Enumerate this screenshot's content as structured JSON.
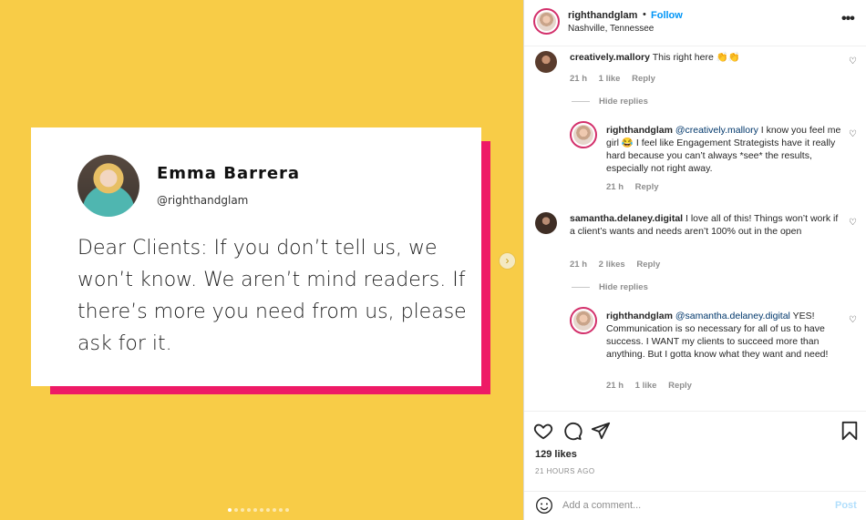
{
  "media": {
    "card": {
      "name": "Emma Barrera",
      "handle": "@righthandglam",
      "quote": "Dear Clients: If you don’t tell us, we won’t know. We aren’t mind readers. If there’s more you need from us, please ask for it."
    },
    "colors": {
      "background": "#f8cc47",
      "accent_shadow": "#ee1a66"
    },
    "carousel": {
      "dots": 10,
      "active_index": 0,
      "next_icon": "chevron-right-icon"
    }
  },
  "post_header": {
    "username": "righthandglam",
    "separator": "•",
    "follow_label": "Follow",
    "location": "Nashville, Tennessee",
    "more_icon": "more-horizontal-icon"
  },
  "comments": [
    {
      "username": "creatively.mallory",
      "text": "This right here 👏👏",
      "time": "21 h",
      "likes": "1 like",
      "reply_label": "Reply",
      "hide_replies": "Hide replies",
      "replies": [
        {
          "username": "righthandglam",
          "mention": "@creatively.mallory",
          "text": " I know you feel me girl 😂 I feel like Engagement Strategists have it really hard because you can’t always *see* the results, especially not right away.",
          "time": "21 h",
          "reply_label": "Reply"
        }
      ]
    },
    {
      "username": "samantha.delaney.digital",
      "text": "I love all of this! Things won’t work if a client’s wants and needs aren’t 100% out in the open",
      "time": "21 h",
      "likes": "2 likes",
      "reply_label": "Reply",
      "hide_replies": "Hide replies",
      "replies": [
        {
          "username": "righthandglam",
          "mention": "@samantha.delaney.digital",
          "text": " YES! Communication is so necessary for all of us to have success. I WANT my clients to succeed more than anything. But I gotta know what they want and need!",
          "time": "21 h",
          "likes": "1 like",
          "reply_label": "Reply"
        }
      ]
    }
  ],
  "actions": {
    "like_icon": "heart-icon",
    "comment_icon": "comment-icon",
    "share_icon": "paper-plane-icon",
    "save_icon": "bookmark-icon",
    "likes": "129 likes",
    "time_ago": "21 HOURS AGO"
  },
  "add_comment": {
    "placeholder": "Add a comment...",
    "post_label": "Post",
    "emoji_icon": "smiley-icon"
  }
}
